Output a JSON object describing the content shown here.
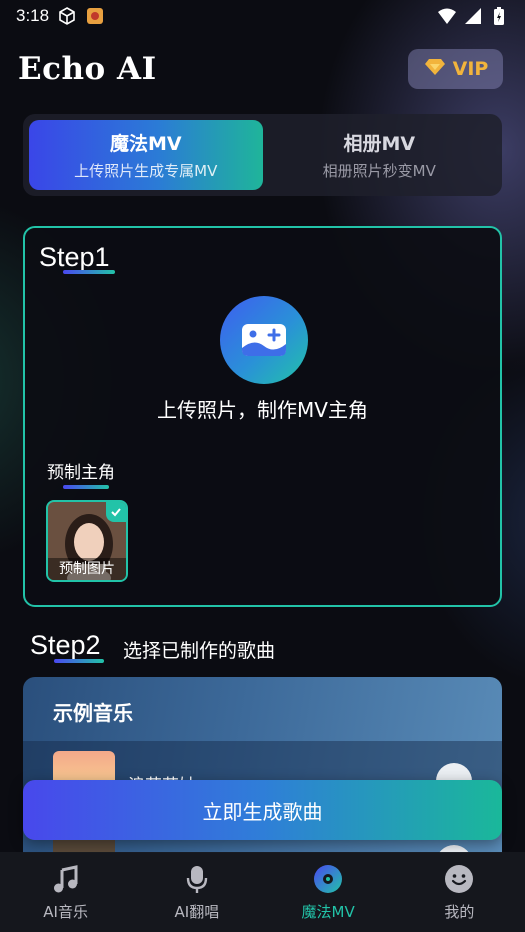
{
  "status_bar": {
    "time": "3:18"
  },
  "header": {
    "title": "Echo AI",
    "vip_label": "VIP"
  },
  "mode_tabs": [
    {
      "title": "魔法MV",
      "subtitle": "上传照片生成专属MV",
      "active": true
    },
    {
      "title": "相册MV",
      "subtitle": "相册照片秒变MV",
      "active": false
    }
  ],
  "step1": {
    "title": "Step1",
    "upload_text": "上传照片，制作MV主角",
    "preset_label": "预制主角",
    "preset_caption": "预制图片"
  },
  "step2": {
    "title": "Step2",
    "subtitle": "选择已制作的歌曲",
    "panel_title": "示例音乐",
    "songs": [
      {
        "title": "浪花花姑"
      }
    ]
  },
  "generate_button": "立即生成歌曲",
  "tab_bar": [
    {
      "label": "AI音乐",
      "icon": "music-note-icon",
      "active": false
    },
    {
      "label": "AI翻唱",
      "icon": "microphone-icon",
      "active": false
    },
    {
      "label": "魔法MV",
      "icon": "disc-icon",
      "active": true
    },
    {
      "label": "我的",
      "icon": "smiley-icon",
      "active": false
    }
  ],
  "colors": {
    "accent": "#22c3a8",
    "brand_blue": "#4848ec",
    "vip_gold": "#f2b43c"
  }
}
